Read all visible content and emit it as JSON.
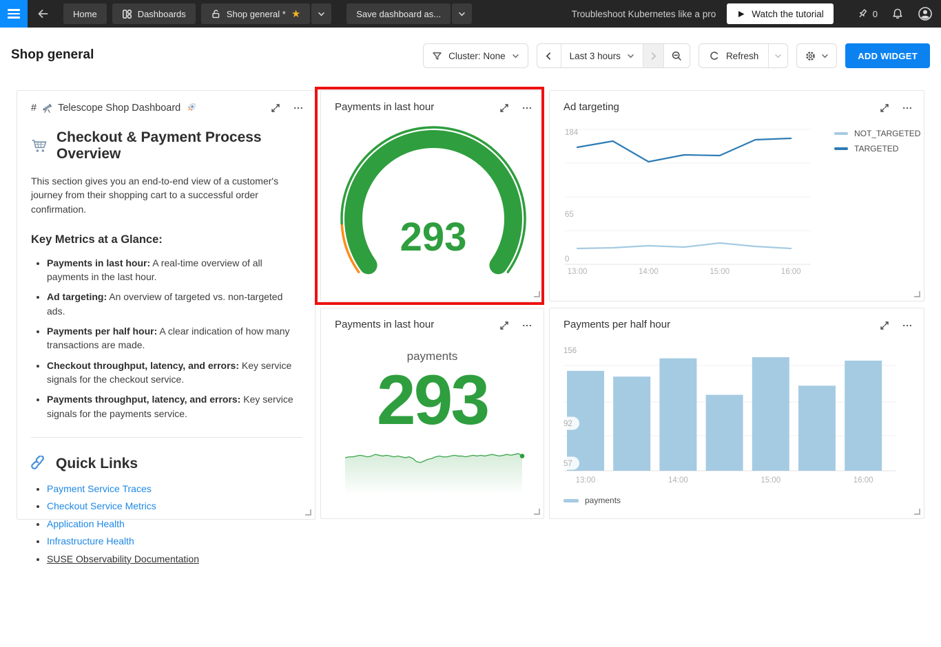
{
  "topbar": {
    "home_label": "Home",
    "dashboards_label": "Dashboards",
    "dashboard_tab_label": "Shop general *",
    "save_dashboard_label": "Save dashboard as...",
    "promo_text": "Troubleshoot Kubernetes like a pro",
    "watch_tutorial_label": "Watch the tutorial",
    "pin_count": "0"
  },
  "page_header": {
    "title": "Shop general",
    "cluster_label": "Cluster: None",
    "time_range_label": "Last 3 hours",
    "refresh_label": "Refresh",
    "add_widget_label": "ADD WIDGET"
  },
  "markdown_widget": {
    "title_prefix": "#",
    "title_text": "Telescope Shop Dashboard",
    "overview_heading": "Checkout & Payment Process Overview",
    "intro": "This section gives you an end-to-end view of a customer's journey from their shopping cart to a successful order confirmation.",
    "metrics_heading": "Key Metrics at a Glance:",
    "metrics": [
      {
        "term": "Payments in last hour:",
        "desc": " A real-time overview of all payments in the last hour."
      },
      {
        "term": "Ad targeting:",
        "desc": " An overview of targeted vs. non-targeted ads."
      },
      {
        "term": "Payments per half hour:",
        "desc": " A clear indication of how many transactions are made."
      },
      {
        "term": "Checkout throughput, latency, and errors:",
        "desc": " Key service signals for the checkout service."
      },
      {
        "term": "Payments throughput, latency, and errors:",
        "desc": " Key service signals for the payments service."
      }
    ],
    "quick_links_heading": "Quick Links",
    "quick_links": [
      {
        "label": "Payment Service Traces",
        "style": "link"
      },
      {
        "label": "Checkout Service Metrics",
        "style": "link"
      },
      {
        "label": "Application Health",
        "style": "link"
      },
      {
        "label": "Infrastructure Health",
        "style": "link"
      },
      {
        "label": "SUSE Observability Documentation",
        "style": "plain-underline"
      }
    ]
  },
  "widgets": {
    "gauge_title": "Payments in last hour",
    "ad_title": "Ad targeting",
    "number_title": "Payments in last hour",
    "bar_title": "Payments per half hour"
  },
  "colors": {
    "green": "#2f9e3e",
    "spark_green": "#3aa549",
    "orange": "#ff8c1a",
    "light_blue": "#a5cbe2",
    "dark_blue": "#2e7cb5",
    "accent_blue": "#0b82f0",
    "link_blue": "#1e88e5",
    "highlight_red": "#ee1111"
  },
  "chart_data": [
    {
      "id": "gauge",
      "type": "gauge",
      "title": "Payments in last hour",
      "series_label": "payments",
      "value": 293,
      "min": 0,
      "max": 293,
      "orange_zone_end_fraction": 0.13
    },
    {
      "id": "ad_targeting",
      "type": "line",
      "title": "Ad targeting",
      "x": [
        "13:00",
        "13:30",
        "14:00",
        "14:30",
        "15:00",
        "15:30",
        "16:00"
      ],
      "x_tick_labels": [
        "13:00",
        "14:00",
        "15:00",
        "16:00"
      ],
      "yticks": [
        184,
        65,
        0
      ],
      "ylim": [
        0,
        196
      ],
      "grid": true,
      "legend_position": "right",
      "series": [
        {
          "name": "NOT_TARGETED",
          "color": "#a5cbe2",
          "values": [
            15,
            16,
            19,
            17,
            23,
            18,
            15
          ]
        },
        {
          "name": "TARGETED",
          "color": "#2e7cb5",
          "values": [
            162,
            171,
            141,
            151,
            150,
            173,
            175
          ]
        }
      ]
    },
    {
      "id": "payments_number",
      "type": "number+sparkline",
      "title": "Payments in last hour",
      "series_label": "payments",
      "value": 293,
      "spark": [
        291,
        292,
        292,
        293,
        294,
        293,
        292,
        293,
        295,
        294,
        293,
        294,
        293,
        292,
        293,
        292,
        291,
        292,
        290,
        286,
        285,
        287,
        289,
        290,
        292,
        293,
        292,
        292,
        293,
        294,
        293,
        293,
        292,
        293,
        294,
        293,
        294,
        293,
        294,
        295,
        294,
        293,
        294,
        295,
        294,
        295,
        296,
        293
      ]
    },
    {
      "id": "payments_half_hour",
      "type": "bar",
      "title": "Payments per half hour",
      "categories": [
        "13:00",
        "13:30",
        "14:00",
        "14:30",
        "15:00",
        "15:30",
        "16:00"
      ],
      "x_tick_labels": [
        "13:00",
        "14:00",
        "15:00",
        "16:00"
      ],
      "values": [
        138,
        133,
        149,
        117,
        150,
        125,
        147
      ],
      "yticks": [
        156,
        92,
        57
      ],
      "grid": true,
      "legend": "payments",
      "bar_color": "#a5cbe2"
    }
  ]
}
